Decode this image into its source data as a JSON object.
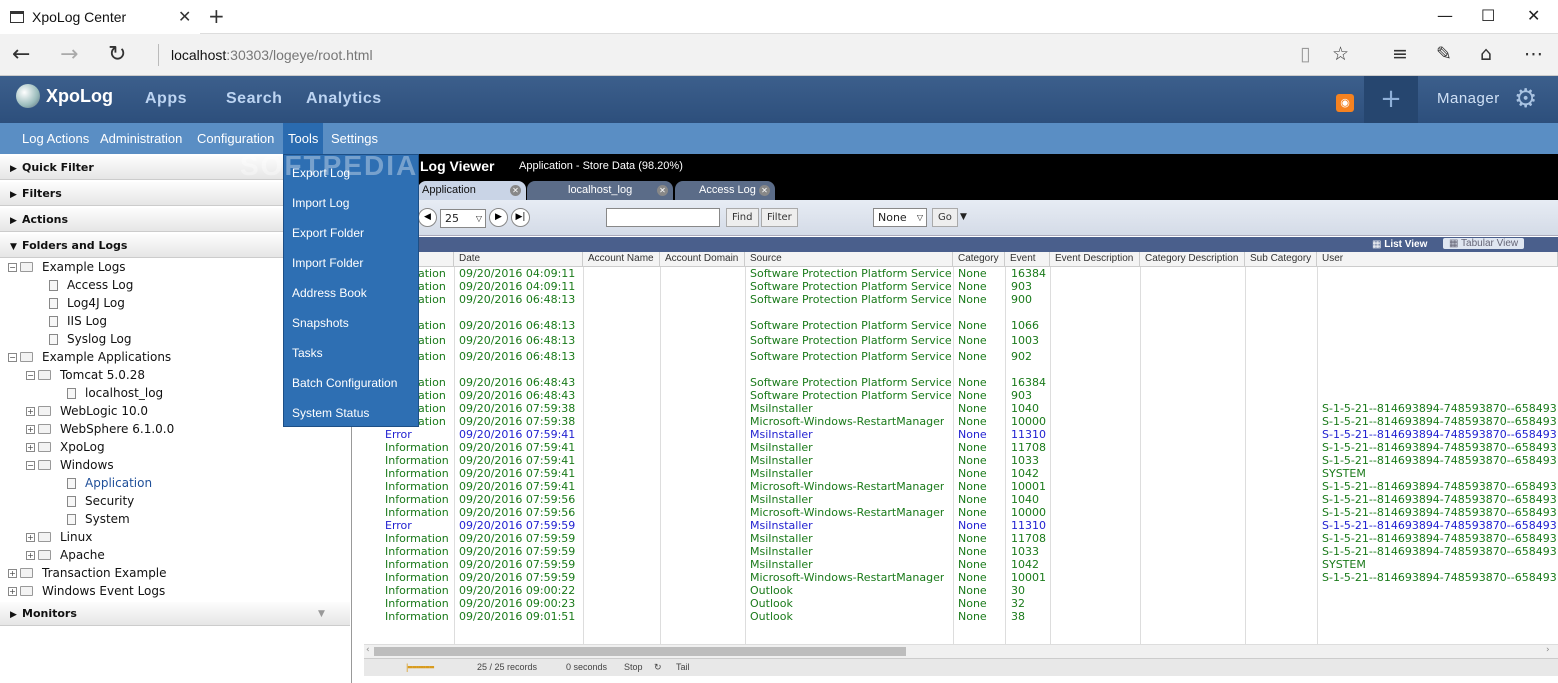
{
  "browser": {
    "tab_title": "XpoLog Center",
    "url_host": "localhost",
    "url_rest": ":30303/logeye/root.html"
  },
  "app": {
    "logo": "XpoLog",
    "nav": [
      "Apps",
      "Search",
      "Analytics"
    ],
    "manager": "Manager"
  },
  "menubar": {
    "items": [
      "Log Actions",
      "Administration",
      "Configuration",
      "Tools",
      "Settings"
    ]
  },
  "tools_menu": {
    "items": [
      "Export Log",
      "Import Log",
      "Export Folder",
      "Import Folder",
      "Address Book",
      "Snapshots",
      "Tasks",
      "Batch Configuration",
      "System Status"
    ]
  },
  "left_panel": {
    "sections": [
      "Quick Filter",
      "Filters",
      "Actions",
      "Folders and Logs",
      "Monitors"
    ],
    "tree": [
      {
        "label": "Example Logs",
        "level": 0,
        "type": "folder",
        "expanded": true
      },
      {
        "label": "Access Log",
        "level": 1,
        "type": "log"
      },
      {
        "label": "Log4J Log",
        "level": 1,
        "type": "log"
      },
      {
        "label": "IIS Log",
        "level": 1,
        "type": "log"
      },
      {
        "label": "Syslog Log",
        "level": 1,
        "type": "log"
      },
      {
        "label": "Example Applications",
        "level": 0,
        "type": "folder",
        "expanded": true
      },
      {
        "label": "Tomcat 5.0.28",
        "level": 1,
        "type": "folder",
        "expanded": true
      },
      {
        "label": "localhost_log",
        "level": 2,
        "type": "log"
      },
      {
        "label": "WebLogic 10.0",
        "level": 1,
        "type": "folder",
        "expanded": false
      },
      {
        "label": "WebSphere 6.1.0.0",
        "level": 1,
        "type": "folder",
        "expanded": false
      },
      {
        "label": "XpoLog",
        "level": 1,
        "type": "folder",
        "expanded": false
      },
      {
        "label": "Windows",
        "level": 1,
        "type": "folder",
        "expanded": true
      },
      {
        "label": "Application",
        "level": 2,
        "type": "log",
        "selected": true
      },
      {
        "label": "Security",
        "level": 2,
        "type": "log"
      },
      {
        "label": "System",
        "level": 2,
        "type": "log"
      },
      {
        "label": "Linux",
        "level": 1,
        "type": "folder",
        "expanded": false
      },
      {
        "label": "Apache",
        "level": 1,
        "type": "folder",
        "expanded": false
      },
      {
        "label": "Transaction Example",
        "level": 0,
        "type": "folder",
        "expanded": false
      },
      {
        "label": "Windows Event Logs",
        "level": 0,
        "type": "folder",
        "expanded": false
      }
    ]
  },
  "viewer": {
    "title": "Log Viewer",
    "subtitle": "Application  - Store Data (98.20%)",
    "tabs": [
      "Application",
      "localhost_log",
      "Access Log"
    ],
    "page_size": "25",
    "find_label": "Find",
    "filter_label": "Filter",
    "none_option": "None",
    "go_label": "Go",
    "list_view": "List View",
    "tabular_view": "Tabular View",
    "columns": [
      "Date",
      "Account Name",
      "Account Domain",
      "Source",
      "Category",
      "Event",
      "Event Description",
      "Category Description",
      "Sub Category",
      "User"
    ],
    "rows": [
      {
        "type": "ation",
        "date": "09/20/2016 04:09:11",
        "source": "Software Protection Platform Service",
        "category": "None",
        "event": "16384",
        "user": "",
        "level": "info"
      },
      {
        "type": "ation",
        "date": "09/20/2016 04:09:11",
        "source": "Software Protection Platform Service",
        "category": "None",
        "event": "903",
        "user": "",
        "level": "info"
      },
      {
        "type": "ation",
        "date": "09/20/2016 06:48:13",
        "source": "Software Protection Platform Service",
        "category": "None",
        "event": "900",
        "user": "",
        "level": "info"
      },
      {
        "type": "ation",
        "date": "09/20/2016 06:48:13",
        "source": "Software Protection Platform Service",
        "category": "None",
        "event": "1066",
        "user": "",
        "level": "info"
      },
      {
        "type": "ation",
        "date": "09/20/2016 06:48:13",
        "source": "Software Protection Platform Service",
        "category": "None",
        "event": "1003",
        "user": "",
        "level": "info"
      },
      {
        "type": "ation",
        "date": "09/20/2016 06:48:13",
        "source": "Software Protection Platform Service",
        "category": "None",
        "event": "902",
        "user": "",
        "level": "info"
      },
      {
        "type": "ation",
        "date": "09/20/2016 06:48:43",
        "source": "Software Protection Platform Service",
        "category": "None",
        "event": "16384",
        "user": "",
        "level": "info"
      },
      {
        "type": "ation",
        "date": "09/20/2016 06:48:43",
        "source": "Software Protection Platform Service",
        "category": "None",
        "event": "903",
        "user": "",
        "level": "info"
      },
      {
        "type": "ation",
        "date": "09/20/2016 07:59:38",
        "source": "MsiInstaller",
        "category": "None",
        "event": "1040",
        "user": "S-1-5-21--814693894-748593870--658493",
        "level": "info"
      },
      {
        "type": "ation",
        "date": "09/20/2016 07:59:38",
        "source": "Microsoft-Windows-RestartManager",
        "category": "None",
        "event": "10000",
        "user": "S-1-5-21--814693894-748593870--658493",
        "level": "info"
      },
      {
        "type": "Error",
        "date": "09/20/2016 07:59:41",
        "source": "MsiInstaller",
        "category": "None",
        "event": "11310",
        "user": "S-1-5-21--814693894-748593870--658493",
        "level": "error"
      },
      {
        "type": "Information",
        "date": "09/20/2016 07:59:41",
        "source": "MsiInstaller",
        "category": "None",
        "event": "11708",
        "user": "S-1-5-21--814693894-748593870--658493",
        "level": "info"
      },
      {
        "type": "Information",
        "date": "09/20/2016 07:59:41",
        "source": "MsiInstaller",
        "category": "None",
        "event": "1033",
        "user": "S-1-5-21--814693894-748593870--658493",
        "level": "info"
      },
      {
        "type": "Information",
        "date": "09/20/2016 07:59:41",
        "source": "MsiInstaller",
        "category": "None",
        "event": "1042",
        "user": "SYSTEM",
        "level": "info"
      },
      {
        "type": "Information",
        "date": "09/20/2016 07:59:41",
        "source": "Microsoft-Windows-RestartManager",
        "category": "None",
        "event": "10001",
        "user": "S-1-5-21--814693894-748593870--658493",
        "level": "info"
      },
      {
        "type": "Information",
        "date": "09/20/2016 07:59:56",
        "source": "MsiInstaller",
        "category": "None",
        "event": "1040",
        "user": "S-1-5-21--814693894-748593870--658493",
        "level": "info"
      },
      {
        "type": "Information",
        "date": "09/20/2016 07:59:56",
        "source": "Microsoft-Windows-RestartManager",
        "category": "None",
        "event": "10000",
        "user": "S-1-5-21--814693894-748593870--658493",
        "level": "info"
      },
      {
        "type": "Error",
        "date": "09/20/2016 07:59:59",
        "source": "MsiInstaller",
        "category": "None",
        "event": "11310",
        "user": "S-1-5-21--814693894-748593870--658493",
        "level": "error"
      },
      {
        "type": "Information",
        "date": "09/20/2016 07:59:59",
        "source": "MsiInstaller",
        "category": "None",
        "event": "11708",
        "user": "S-1-5-21--814693894-748593870--658493",
        "level": "info"
      },
      {
        "type": "Information",
        "date": "09/20/2016 07:59:59",
        "source": "MsiInstaller",
        "category": "None",
        "event": "1033",
        "user": "S-1-5-21--814693894-748593870--658493",
        "level": "info"
      },
      {
        "type": "Information",
        "date": "09/20/2016 07:59:59",
        "source": "MsiInstaller",
        "category": "None",
        "event": "1042",
        "user": "SYSTEM",
        "level": "info"
      },
      {
        "type": "Information",
        "date": "09/20/2016 07:59:59",
        "source": "Microsoft-Windows-RestartManager",
        "category": "None",
        "event": "10001",
        "user": "S-1-5-21--814693894-748593870--658493",
        "level": "info"
      },
      {
        "type": "Information",
        "date": "09/20/2016 09:00:22",
        "source": "Outlook",
        "category": "None",
        "event": "30",
        "user": "",
        "level": "info"
      },
      {
        "type": "Information",
        "date": "09/20/2016 09:00:23",
        "source": "Outlook",
        "category": "None",
        "event": "32",
        "user": "",
        "level": "info"
      },
      {
        "type": "Information",
        "date": "09/20/2016 09:01:51",
        "source": "Outlook",
        "category": "None",
        "event": "38",
        "user": "",
        "level": "info"
      }
    ],
    "status": {
      "records": "25 / 25 records",
      "time": "0 seconds",
      "stop": "Stop",
      "tail": "Tail"
    }
  },
  "colors": {
    "info": "#1a7a1a",
    "error": "#1f1fd0",
    "header": "#2d4f7c",
    "menubar": "#5a8ec4",
    "dropdown": "#2e6fb3"
  },
  "watermark": "SOFTPEDIA"
}
